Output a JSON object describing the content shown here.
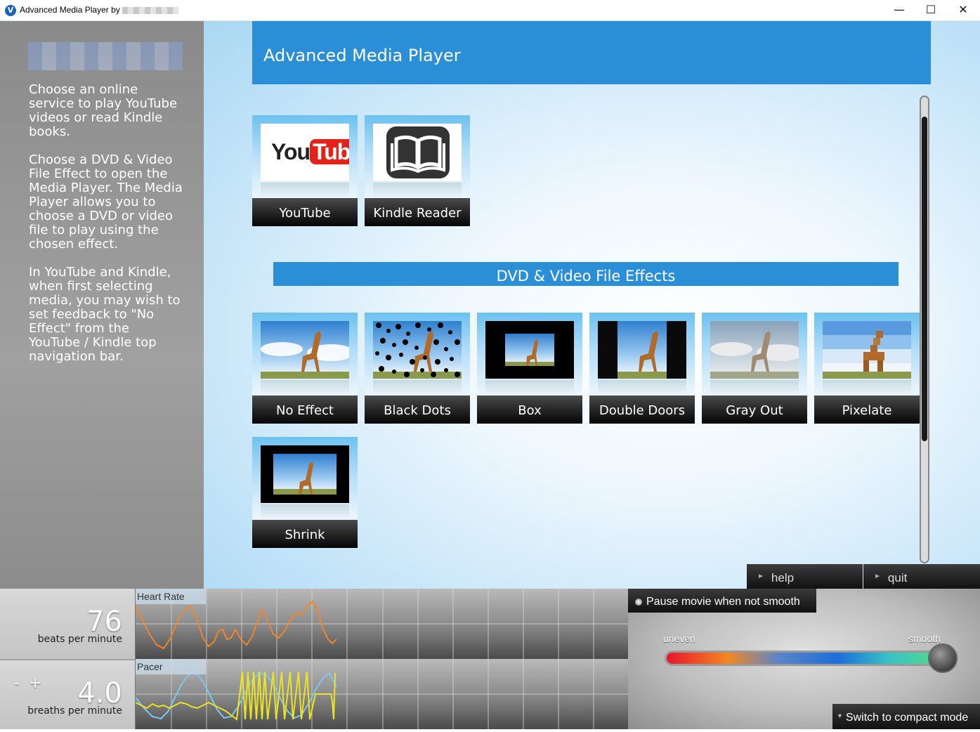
{
  "window": {
    "title": "Advanced Media Player by",
    "minimize": "—",
    "maximize": "☐",
    "close": "✕"
  },
  "sidebar": {
    "paragraphs": [
      "Choose an online service to play YouTube videos or read Kindle books.",
      "Choose a DVD & Video File Effect to open the Media Player. The Media Player allows you to choose a DVD or video file to play using the chosen effect.",
      "In YouTube and Kindle, when first selecting media, you may wish to set feedback to \"No Effect\" from the YouTube / Kindle top navigation bar."
    ]
  },
  "header": {
    "title": "Advanced Media Player"
  },
  "services": [
    {
      "label": "YouTube",
      "logo_you": "You",
      "logo_tube": "Tube",
      "icon": "youtube-logo"
    },
    {
      "label": "Kindle Reader",
      "icon": "book-icon"
    }
  ],
  "effects_section": {
    "title": "DVD & Video File Effects"
  },
  "effects": [
    {
      "label": "No Effect"
    },
    {
      "label": "Black Dots"
    },
    {
      "label": "Box"
    },
    {
      "label": "Double Doors"
    },
    {
      "label": "Gray Out"
    },
    {
      "label": "Pixelate"
    },
    {
      "label": "Shrink"
    }
  ],
  "nav": {
    "help": "help",
    "quit": "quit"
  },
  "heart": {
    "value": "76",
    "unit": "beats per minute",
    "graph_title": "Heart Rate"
  },
  "pacer": {
    "value": "4.0",
    "unit": "breaths per minute",
    "graph_title": "Pacer",
    "minus": "-",
    "plus": "+"
  },
  "smoothness": {
    "pause_label": "Pause movie when not smooth",
    "left_label": "uneven",
    "right_label": "smooth",
    "level": 1.0
  },
  "compact_button": "Switch to compact mode",
  "colors": {
    "accent": "#2a8fd6",
    "heart_line": "#f0862a",
    "pacer_blue": "#7ec8ee",
    "pacer_yellow": "#ece41e"
  }
}
